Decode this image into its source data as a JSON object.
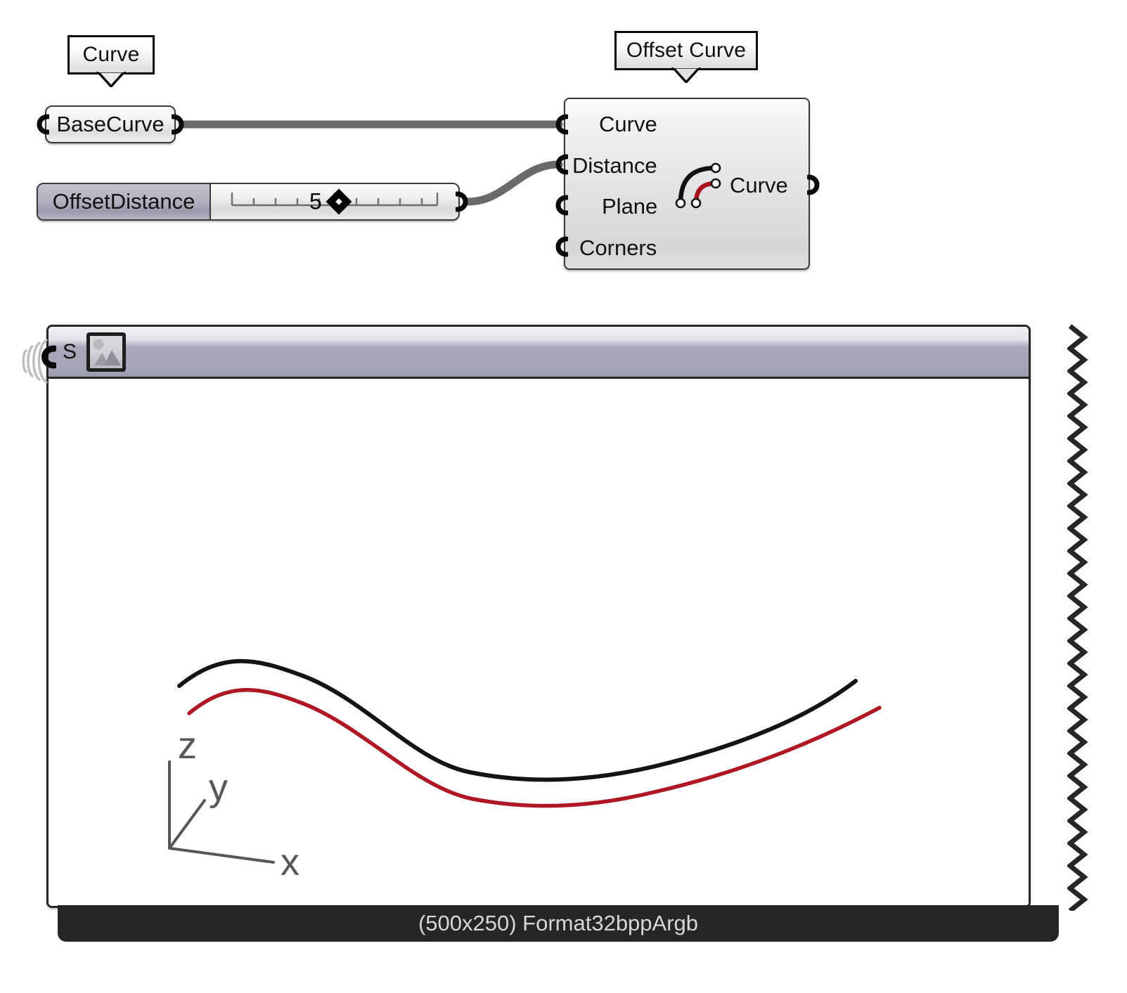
{
  "graph": {
    "balloons": [
      {
        "id": "curve-balloon",
        "label": "Curve"
      },
      {
        "id": "offset-curve-balloon",
        "label": "Offset Curve"
      }
    ],
    "parameters": [
      {
        "id": "base-curve",
        "label": "BaseCurve"
      }
    ],
    "slider": {
      "name": "OffsetDistance",
      "value": "5",
      "grip_icon": "diamond-grip-icon",
      "tick_count": 11
    },
    "component": {
      "title": "Offset Curve",
      "icon": "offset-curve-icon",
      "inputs": [
        {
          "name": "Curve"
        },
        {
          "name": "Distance"
        },
        {
          "name": "Plane"
        },
        {
          "name": "Corners"
        }
      ],
      "outputs": [
        {
          "name": "Curve"
        }
      ]
    },
    "wires": [
      {
        "from": "base-curve-output",
        "to": "component-curve-input"
      },
      {
        "from": "offset-distance-output",
        "to": "component-distance-input"
      }
    ]
  },
  "panel": {
    "header": {
      "flag": "S",
      "icon": "picture-icon"
    },
    "input_port_indicator": "wireless-rings-icon",
    "right_edge": "zigzag-edge",
    "status": "(500x250) Format32bppArgb",
    "viewport": {
      "axis_gizmo": {
        "z_label": "z",
        "y_label": "y",
        "x_label": "x",
        "color": "#575757"
      },
      "curves": [
        {
          "name": "base-curve",
          "color": "#141414"
        },
        {
          "name": "offset-curve",
          "color": "#b01724"
        }
      ]
    }
  },
  "colors": {
    "wire": "#6a6a6a",
    "port": "#0a0a0a",
    "component_border": "#3a3a3a",
    "header_accent": "#a3a3b5",
    "status_bg": "#262626",
    "status_text": "#d7d7d7",
    "base_curve": "#141414",
    "offset_curve": "#b01724"
  }
}
